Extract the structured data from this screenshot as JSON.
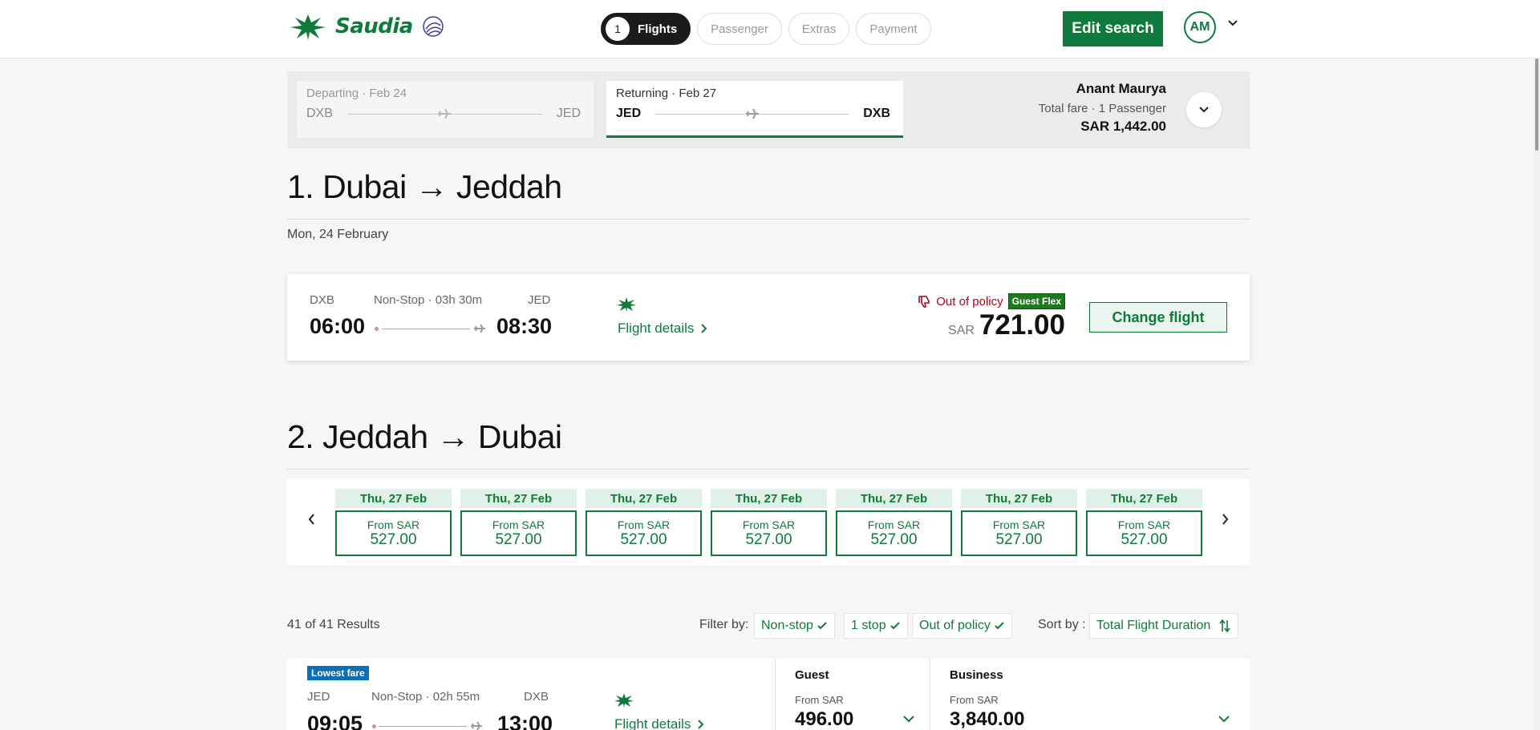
{
  "brand": {
    "name": "Saudia",
    "color": "#0f7a3b"
  },
  "steps": [
    {
      "num": "1",
      "label": "Flights"
    },
    {
      "label": "Passenger"
    },
    {
      "label": "Extras"
    },
    {
      "label": "Payment"
    }
  ],
  "header": {
    "edit_label": "Edit search",
    "avatar_initials": "AM"
  },
  "summary": {
    "departing": {
      "label": "Departing · Feb 24",
      "from": "DXB",
      "to": "JED"
    },
    "returning": {
      "label": "Returning · Feb 27",
      "from": "JED",
      "to": "DXB"
    },
    "passenger_name": "Anant Maurya",
    "fare_label": "Total fare · 1 Passenger",
    "total": "SAR 1,442.00"
  },
  "outbound": {
    "title": "1. Dubai → Jeddah",
    "date": "Mon, 24 February",
    "from": "DXB",
    "to": "JED",
    "meta": "Non-Stop · 03h 30m",
    "dep_time": "06:00",
    "arr_time": "08:30",
    "details_label": "Flight details",
    "policy": "Out of policy",
    "fare_tag": "Guest Flex",
    "currency": "SAR",
    "price": "721.00",
    "change_label": "Change flight"
  },
  "inbound": {
    "title": "2. Jeddah → Dubai",
    "dates": [
      {
        "day": "Thu, 27 Feb",
        "from": "From SAR",
        "amount": "527.00"
      },
      {
        "day": "Thu, 27 Feb",
        "from": "From SAR",
        "amount": "527.00"
      },
      {
        "day": "Thu, 27 Feb",
        "from": "From SAR",
        "amount": "527.00"
      },
      {
        "day": "Thu, 27 Feb",
        "from": "From SAR",
        "amount": "527.00"
      },
      {
        "day": "Thu, 27 Feb",
        "from": "From SAR",
        "amount": "527.00"
      },
      {
        "day": "Thu, 27 Feb",
        "from": "From SAR",
        "amount": "527.00"
      },
      {
        "day": "Thu, 27 Feb",
        "from": "From SAR",
        "amount": "527.00"
      }
    ]
  },
  "results": {
    "count": "41 of 41 Results",
    "filter_label": "Filter by:",
    "filters": [
      "Non-stop",
      "1 stop",
      "Out of policy"
    ],
    "sort_label": "Sort by :",
    "sort_value": "Total Flight Duration"
  },
  "row": {
    "badge": "Lowest fare",
    "from": "JED",
    "to": "DXB",
    "meta": "Non-Stop · 02h 55m",
    "dep_time": "09:05",
    "arr_time": "13:00",
    "details_label": "Flight details",
    "fares": [
      {
        "name": "Guest",
        "from": "From SAR",
        "amount": "496.00"
      },
      {
        "name": "Business",
        "from": "From SAR",
        "amount": "3,840.00"
      }
    ]
  }
}
